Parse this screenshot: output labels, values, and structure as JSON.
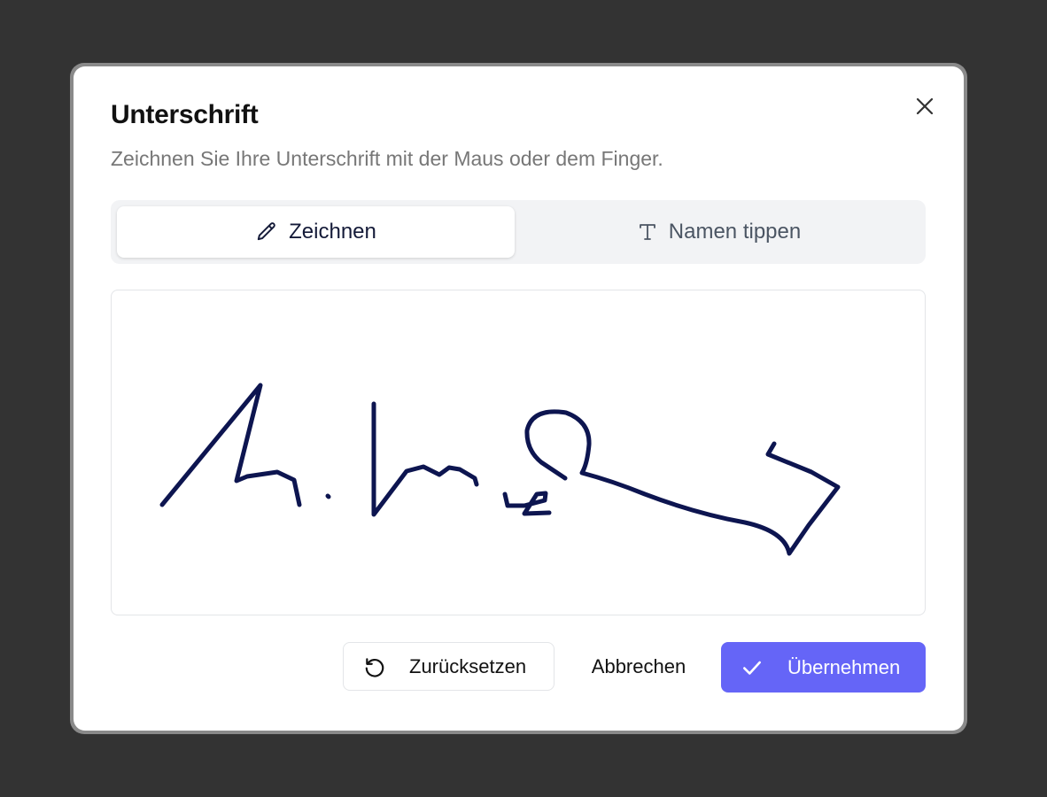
{
  "dialog": {
    "title": "Unterschrift",
    "subtitle": "Zeichnen Sie Ihre Unterschrift mit der Maus oder dem Finger.",
    "close_icon": "close-icon"
  },
  "tabs": [
    {
      "label": "Zeichnen",
      "icon": "pencil-icon",
      "active": true
    },
    {
      "label": "Namen tippen",
      "icon": "text-icon",
      "active": false
    }
  ],
  "canvas": {
    "stroke_color": "#0d1550"
  },
  "actions": {
    "reset_label": "Zurücksetzen",
    "reset_icon": "reset-icon",
    "cancel_label": "Abbrechen",
    "apply_label": "Übernehmen",
    "apply_icon": "check-icon"
  },
  "colors": {
    "backdrop": "#333333",
    "accent": "#6565f7",
    "tab_active_text": "#141a38"
  }
}
